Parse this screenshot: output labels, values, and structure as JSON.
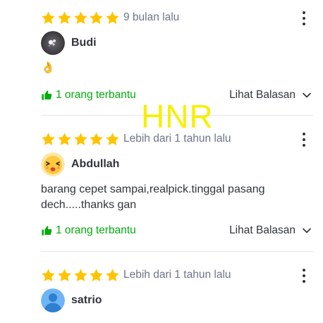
{
  "reviews": [
    {
      "rating": 5,
      "time": "9 bulan lalu",
      "username": "Budi",
      "avatar": "photo-avatar",
      "text": "👌",
      "helpful": "1 orang terbantu",
      "reply": "Lihat Balasan"
    },
    {
      "rating": 5,
      "time": "Lebih dari 1 tahun lalu",
      "username": "Abdullah",
      "avatar": "emoji-avatar",
      "text": "barang cepet sampai,realpick.tinggal pasang dech.....thanks gan",
      "helpful": "1 orang terbantu",
      "reply": "Lihat Balasan"
    },
    {
      "rating": 5,
      "time": "Lebih dari 1 tahun lalu",
      "username": "satrio",
      "avatar": "default-person-avatar"
    }
  ],
  "watermark": "HNR",
  "colors": {
    "star": "#ffc400",
    "helpful_green": "#03ac0e",
    "watermark_yellow": "#f7ef00",
    "text": "#31353b",
    "muted": "#6d7588"
  },
  "icons": {
    "star": "star-icon",
    "more": "more-vertical-icon",
    "helpful": "thumbs-up-icon",
    "expand": "chevron-down-icon"
  }
}
